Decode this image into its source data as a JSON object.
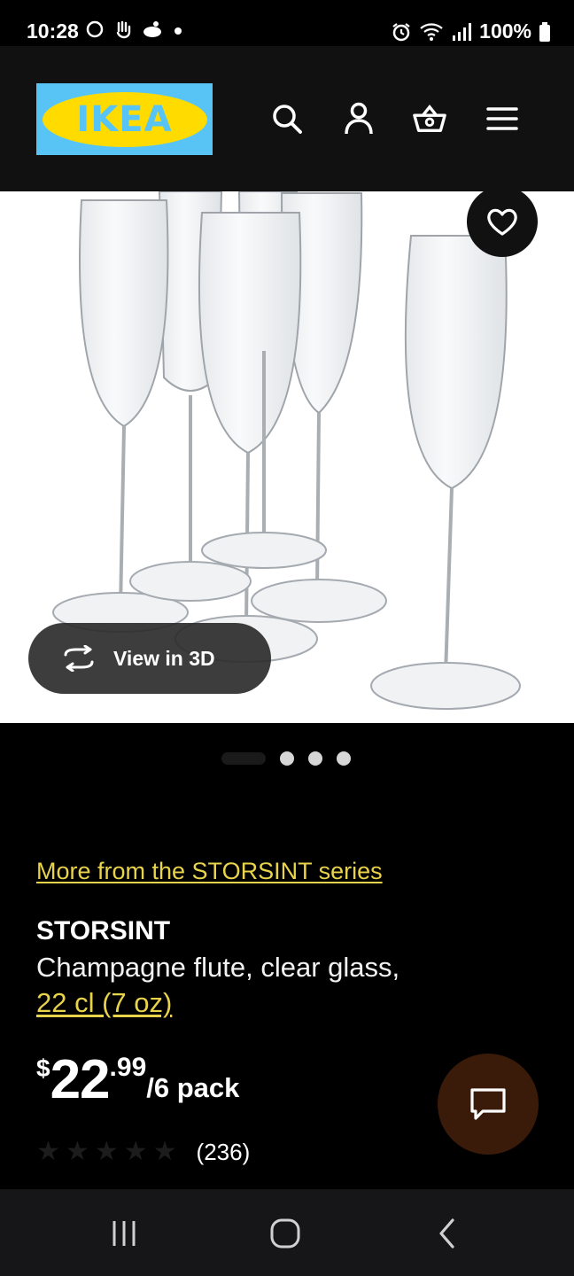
{
  "status_bar": {
    "time": "10:28",
    "battery": "100%",
    "left_icons": [
      "circle-icon",
      "hand-icon",
      "notification-icon",
      "dot-icon"
    ],
    "right_icons": [
      "alarm-icon",
      "wifi-icon",
      "signal-icon",
      "battery-icon"
    ]
  },
  "header": {
    "logo_text": "IKEA",
    "icons": [
      "search-icon",
      "account-icon",
      "basket-icon",
      "menu-icon"
    ],
    "brand_blue": "#58c4f6",
    "brand_yellow": "#ffdb00"
  },
  "product_image": {
    "favorite_icon": "heart-icon",
    "view3d_label": "View in 3D",
    "view3d_icon": "rotate-icon"
  },
  "carousel": {
    "total": 4,
    "active": 1
  },
  "product": {
    "series_link": "More from the STORSINT series",
    "name": "STORSINT",
    "description": "Champagne flute, clear glass,",
    "size_link": "22 cl (7 oz)",
    "price": {
      "currency": "$",
      "integer": "22",
      "decimal": ".99",
      "unit": "/6 pack"
    },
    "rating": {
      "stars": 5,
      "reviews": "(236)"
    },
    "accent_color": "#e8d34a"
  },
  "chat": {
    "icon": "chat-icon"
  },
  "nav_bar": {
    "buttons": [
      "recent-apps-icon",
      "home-icon",
      "back-icon"
    ]
  }
}
